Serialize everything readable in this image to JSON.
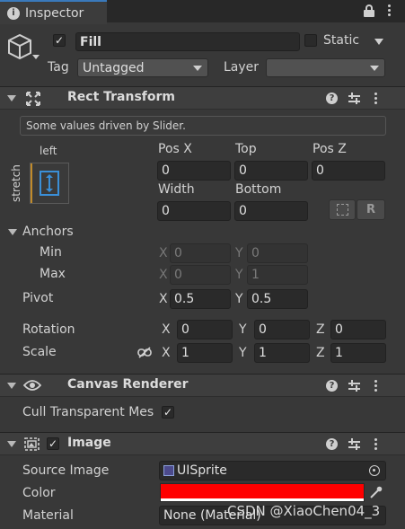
{
  "tab": {
    "title": "Inspector"
  },
  "object": {
    "name": "Fill",
    "active": true,
    "static_label": "Static",
    "static": false,
    "tag_label": "Tag",
    "tag_value": "Untagged",
    "layer_label": "Layer",
    "layer_value": ""
  },
  "rect_transform": {
    "title": "Rect Transform",
    "info": "Some values driven by Slider.",
    "anchor_h_label": "left",
    "anchor_v_label": "stretch",
    "pos_x_label": "Pos X",
    "pos_x": "0",
    "top_label": "Top",
    "top": "0",
    "pos_z_label": "Pos Z",
    "pos_z": "0",
    "width_label": "Width",
    "width": "0",
    "bottom_label": "Bottom",
    "bottom": "0",
    "r_button": "R",
    "anchors_label": "Anchors",
    "min_label": "Min",
    "min_x_label": "X",
    "min_x": "0",
    "min_y_label": "Y",
    "min_y": "0",
    "max_label": "Max",
    "max_x_label": "X",
    "max_x": "0",
    "max_y_label": "Y",
    "max_y": "1",
    "pivot_label": "Pivot",
    "pivot_x_label": "X",
    "pivot_x": "0.5",
    "pivot_y_label": "Y",
    "pivot_y": "0.5",
    "rotation_label": "Rotation",
    "rot_x_label": "X",
    "rot_x": "0",
    "rot_y_label": "Y",
    "rot_y": "0",
    "rot_z_label": "Z",
    "rot_z": "0",
    "scale_label": "Scale",
    "scale_x_label": "X",
    "scale_x": "1",
    "scale_y_label": "Y",
    "scale_y": "1",
    "scale_z_label": "Z",
    "scale_z": "1"
  },
  "canvas_renderer": {
    "title": "Canvas Renderer",
    "cull_label": "Cull Transparent Mes",
    "cull_checked": true
  },
  "image": {
    "title": "Image",
    "enabled": true,
    "source_image_label": "Source Image",
    "source_image": "UISprite",
    "color_label": "Color",
    "color_value": "#ff0000",
    "material_label": "Material",
    "material": "None (Material)"
  },
  "watermark": "CSDN @XiaoChen04_3",
  "colors": {
    "accent": "#3a79bb",
    "panel": "#383838",
    "header": "#3e3e3e"
  }
}
